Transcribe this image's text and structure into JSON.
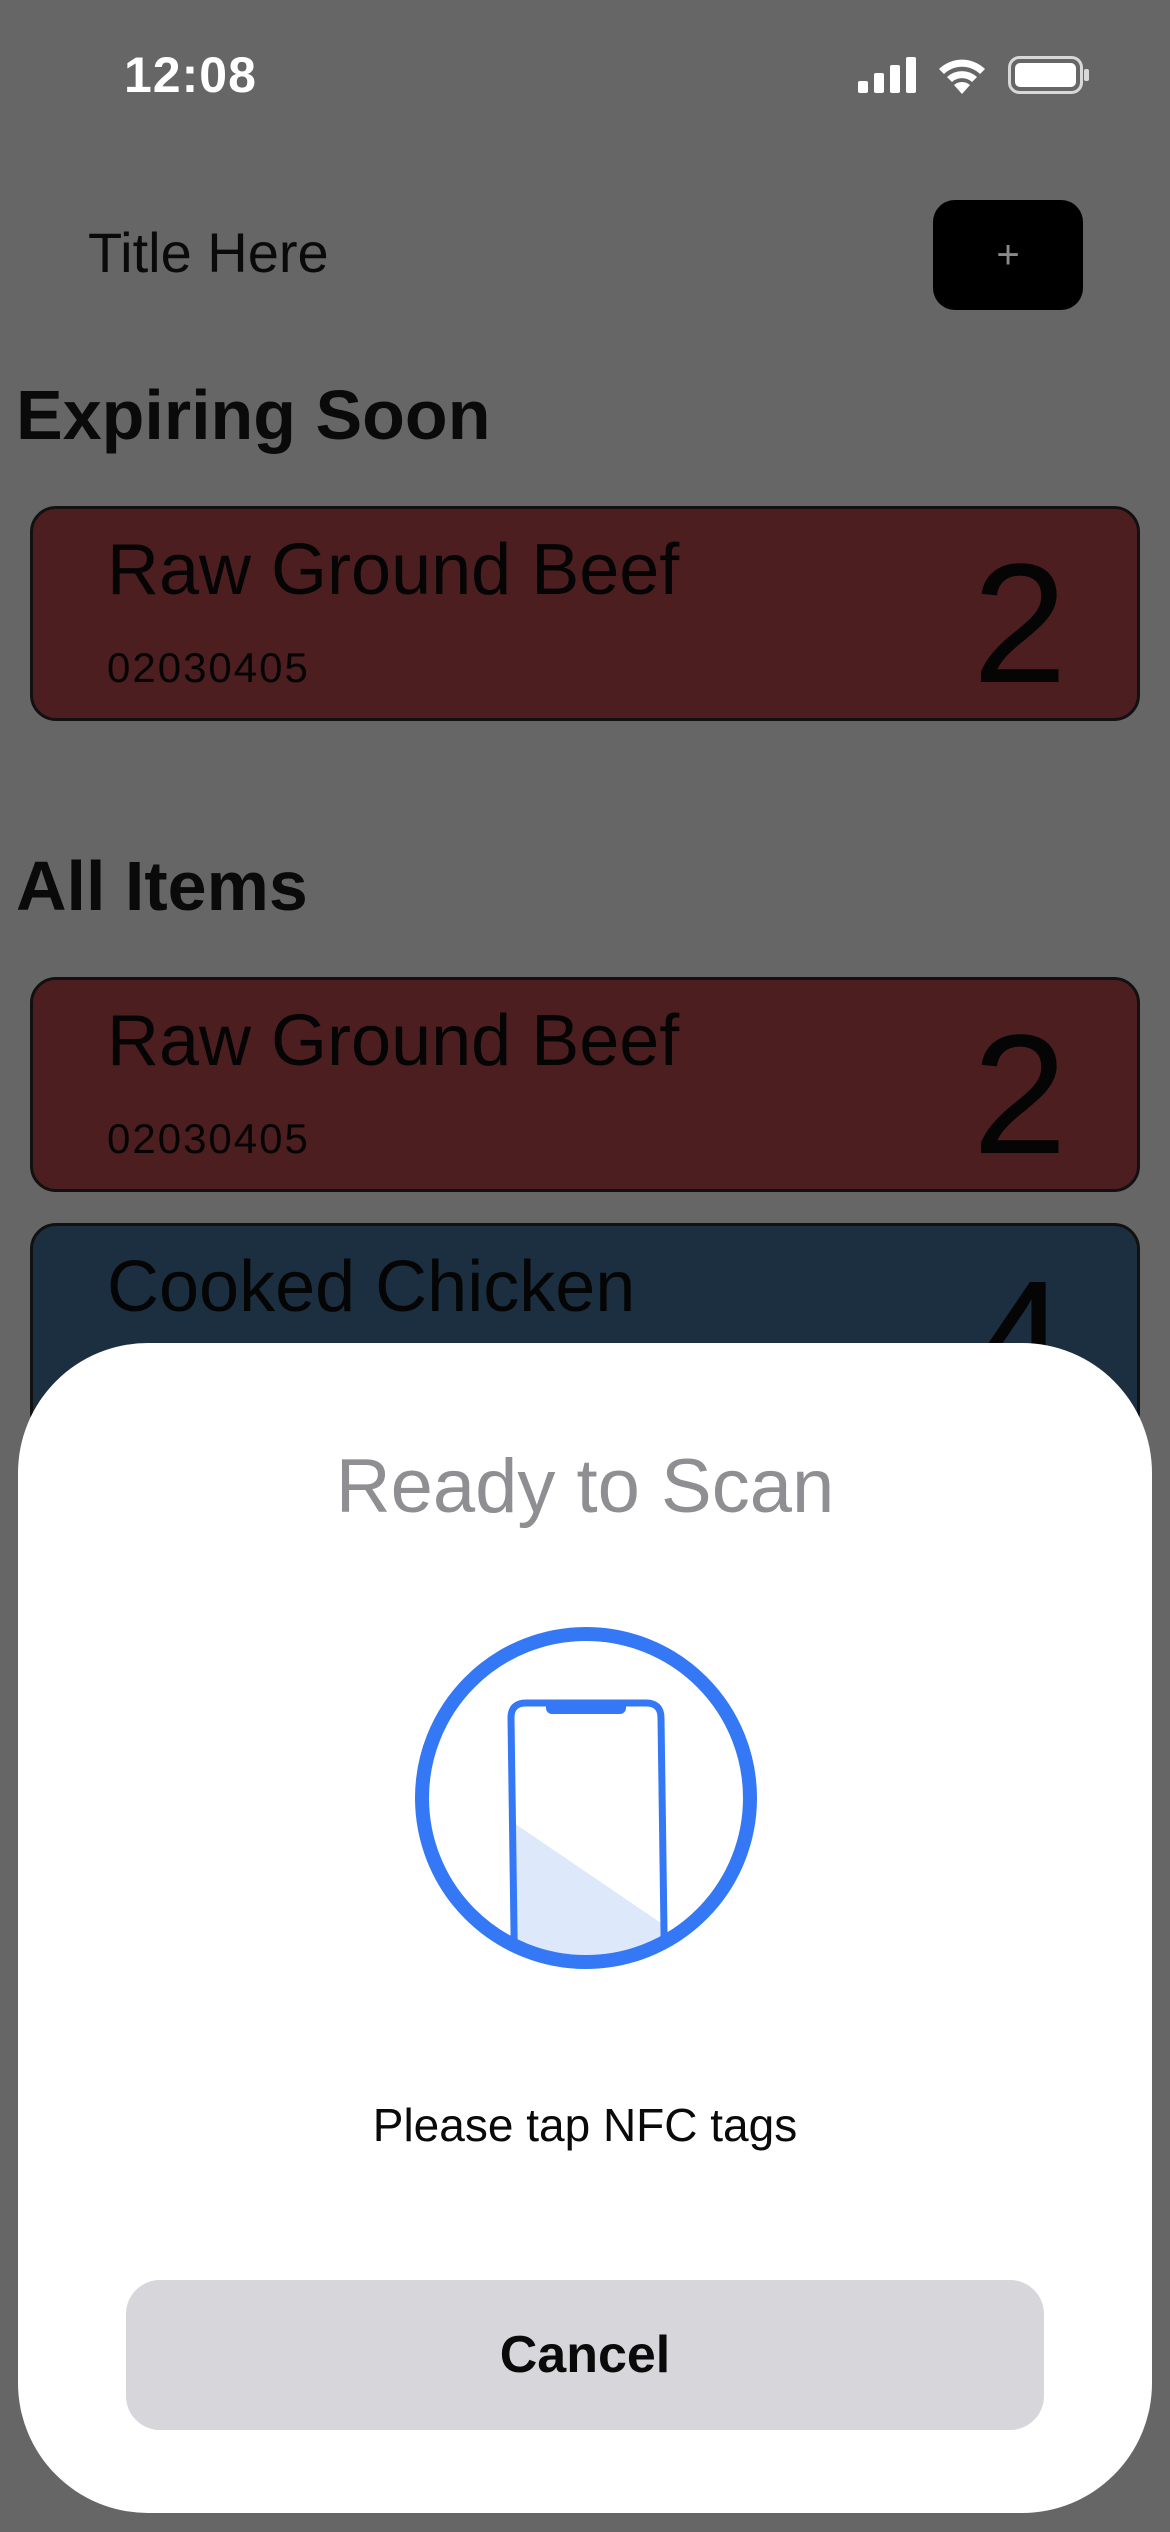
{
  "status_bar": {
    "time": "12:08",
    "icons": [
      "signal-icon",
      "wifi-icon",
      "battery-icon"
    ]
  },
  "header": {
    "title": "Title Here",
    "add_label": "+"
  },
  "sections": {
    "expiring_soon": {
      "heading": "Expiring Soon",
      "items": [
        {
          "name": "Raw Ground Beef",
          "code": "02030405",
          "count": "2",
          "color": "#4d1e1f"
        }
      ]
    },
    "all_items": {
      "heading": "All Items",
      "items": [
        {
          "name": "Raw Ground Beef",
          "code": "02030405",
          "count": "2",
          "color": "#4d1e1f"
        },
        {
          "name": "Cooked Chicken",
          "count": "4",
          "color": "#1b2f40"
        }
      ]
    }
  },
  "nfc_sheet": {
    "title": "Ready to Scan",
    "icon": "phone-scan-icon",
    "message": "Please tap NFC tags",
    "cancel_label": "Cancel",
    "accent_color": "#3478f6"
  }
}
